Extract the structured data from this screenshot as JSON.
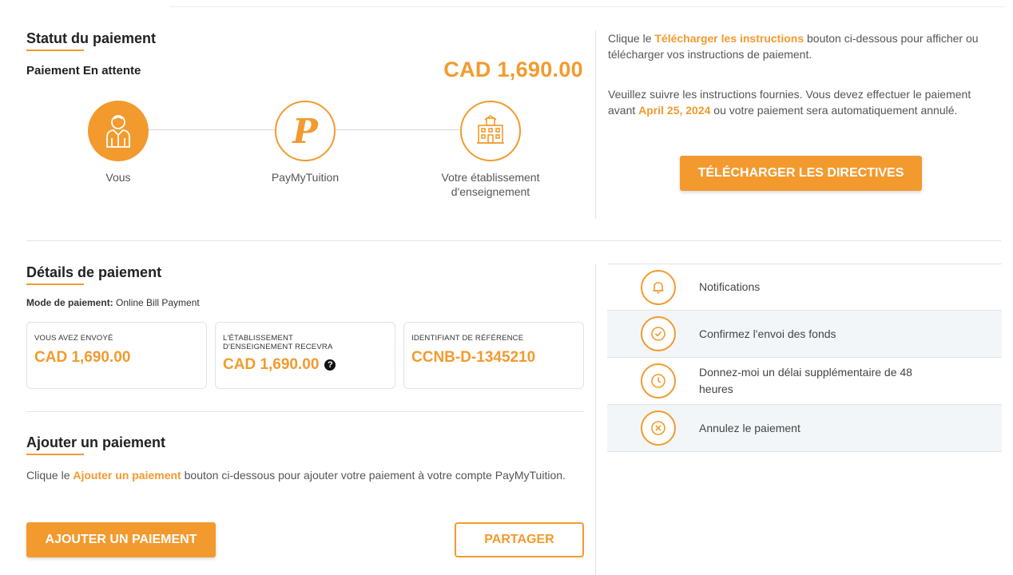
{
  "status": {
    "title": "Statut du paiement",
    "state": "Paiement En attente",
    "amount": "CAD 1,690.00",
    "steps": [
      {
        "label": "Vous",
        "icon": "person-icon"
      },
      {
        "label": "PayMyTuition",
        "icon": "paymytuition-logo"
      },
      {
        "label": "Votre établissement d'enseignement",
        "icon": "school-building-icon"
      }
    ]
  },
  "instructions": {
    "line1_prefix": "Clique le ",
    "line1_link": "Télécharger les instructions",
    "line1_suffix": " bouton ci-dessous pour afficher ou télécharger vos instructions de paiement.",
    "line2_prefix": "Veuillez suivre les instructions fournies. Vous devez effectuer le paiement avant ",
    "line2_date": "April 25, 2024",
    "line2_suffix": " ou votre paiement sera automatiquement annulé.",
    "download_button": "TÉLÉCHARGER LES DIRECTIVES"
  },
  "details": {
    "title": "Détails de paiement",
    "mode_label": "Mode de paiement:",
    "mode_value": " Online Bill Payment",
    "cards": [
      {
        "label": "VOUS AVEZ ENVOYÉ",
        "value": "CAD 1,690.00",
        "help": false
      },
      {
        "label": "L'ÉTABLISSEMENT D'ENSEIGNEMENT RECEVRA",
        "value": "CAD 1,690.00",
        "help": true
      },
      {
        "label": "IDENTIFIANT DE RÉFÉRENCE",
        "value": "CCNB-D-1345210",
        "help": false
      }
    ]
  },
  "add_payment": {
    "title": "Ajouter un paiement",
    "text_prefix": "Clique le ",
    "text_link": "Ajouter un paiement",
    "text_suffix": " bouton ci-dessous pour ajouter votre paiement à votre compte PayMyTuition.",
    "add_button": "AJOUTER UN PAIEMENT",
    "share_button": "PARTAGER"
  },
  "actions": [
    {
      "label": "Notifications",
      "icon": "bell-icon"
    },
    {
      "label": "Confirmez l'envoi des fonds",
      "icon": "check-icon"
    },
    {
      "label": "Donnez-moi un délai supplémentaire de 48 heures",
      "icon": "clock-icon"
    },
    {
      "label": "Annulez le paiement",
      "icon": "cancel-icon"
    }
  ],
  "colors": {
    "accent": "#f39a2e",
    "row_shade": "#f3f6f8"
  }
}
